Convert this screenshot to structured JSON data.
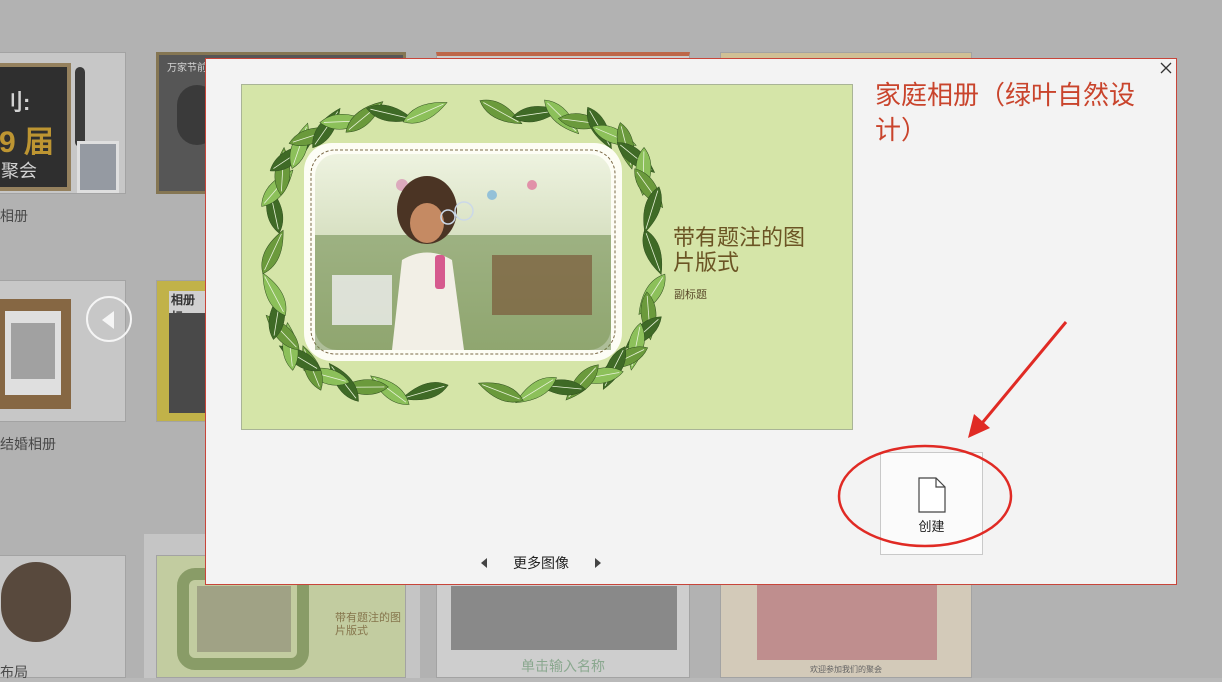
{
  "background": {
    "card1": {
      "line1": "刂:",
      "line2": "9 届",
      "line3": "聚会"
    },
    "card1_label": "相册",
    "card2_label": "万家节前夕",
    "card5_label": "结婚相册",
    "card6_label": "相册标",
    "card7_label": "布局",
    "card8_caption": "带有题注的图片版式",
    "card8_sub": "副标题",
    "card9_caption": "单击输入名称",
    "card10_caption": "欢迎参加我们的聚会"
  },
  "dialog": {
    "title": "家庭相册（绿叶自然设计）",
    "close_icon": "close-icon",
    "preview": {
      "title": "带有题注的图片版式",
      "subtitle": "副标题"
    },
    "more_images_label": "更多图像",
    "create_label": "创建"
  },
  "colors": {
    "dialog_title": "#c9442c",
    "accent_border": "#c8453a",
    "leaf_light": "#8cc05a",
    "leaf_dark": "#3f6a26",
    "annotation": "#e02a24"
  }
}
